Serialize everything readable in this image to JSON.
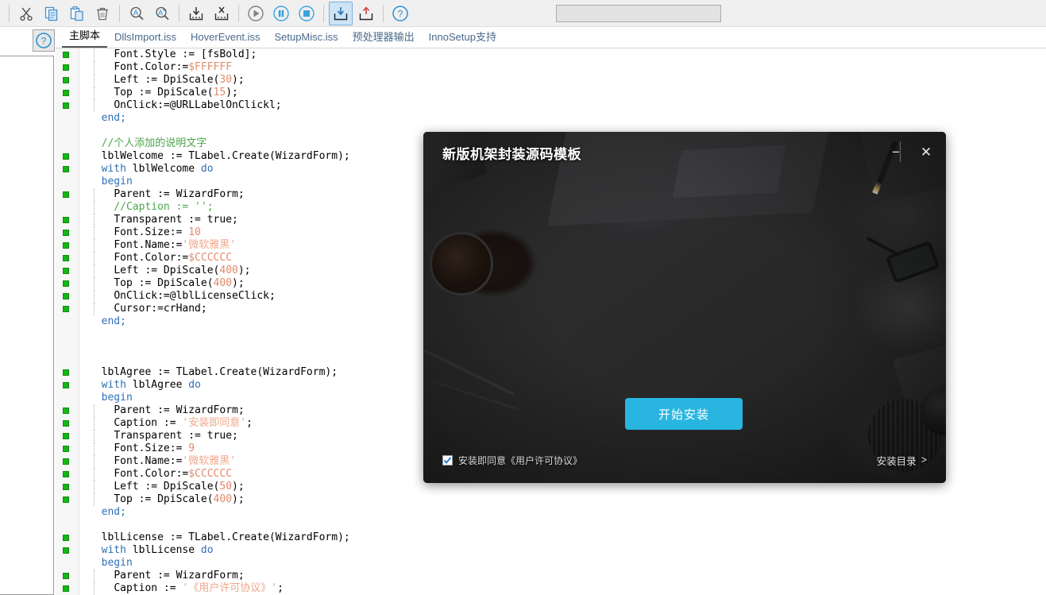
{
  "toolbar": {
    "buttons": [
      {
        "name": "cut-icon",
        "label": "剪切"
      },
      {
        "name": "copy-icon",
        "label": "复制"
      },
      {
        "name": "paste-icon",
        "label": "粘贴"
      },
      {
        "name": "delete-icon",
        "label": "删除"
      },
      {
        "name": "find-icon",
        "label": "查找"
      },
      {
        "name": "replace-icon",
        "label": "替换"
      },
      {
        "name": "import-icon",
        "label": "导入"
      },
      {
        "name": "remove-import-icon",
        "label": "移除导入"
      },
      {
        "name": "run-icon",
        "label": "运行"
      },
      {
        "name": "pause-icon",
        "label": "暂停"
      },
      {
        "name": "stop-icon",
        "label": "停止"
      },
      {
        "name": "download-icon",
        "label": "下载"
      },
      {
        "name": "upload-icon",
        "label": "上传"
      },
      {
        "name": "help-icon",
        "label": "帮助"
      }
    ],
    "search_value": "",
    "search_placeholder": ""
  },
  "help_button": {
    "glyph": "?",
    "label": "帮助"
  },
  "tabs": [
    {
      "label": "主脚本",
      "active": true
    },
    {
      "label": "DllsImport.iss",
      "active": false
    },
    {
      "label": "HoverEvent.iss",
      "active": false
    },
    {
      "label": "SetupMisc.iss",
      "active": false
    },
    {
      "label": "预处理器输出",
      "active": false
    },
    {
      "label": "InnoSetup支持",
      "active": false
    }
  ],
  "editor": {
    "lines": [
      {
        "marker": true,
        "indent": 4,
        "tokens": [
          {
            "t": "Font.Style := ",
            "c": "id"
          },
          {
            "t": "[fsBold];",
            "c": "pun"
          }
        ]
      },
      {
        "marker": true,
        "indent": 4,
        "tokens": [
          {
            "t": "Font.Color:=",
            "c": "id"
          },
          {
            "t": "$FFFFFF",
            "c": "num"
          }
        ]
      },
      {
        "marker": true,
        "indent": 4,
        "tokens": [
          {
            "t": "Left := DpiScale(",
            "c": "id"
          },
          {
            "t": "30",
            "c": "num"
          },
          {
            "t": ");",
            "c": "pun"
          }
        ]
      },
      {
        "marker": true,
        "indent": 4,
        "tokens": [
          {
            "t": "Top := DpiScale(",
            "c": "id"
          },
          {
            "t": "15",
            "c": "num"
          },
          {
            "t": ");",
            "c": "pun"
          }
        ]
      },
      {
        "marker": true,
        "indent": 4,
        "tokens": [
          {
            "t": "OnClick:=@URLLabelOnClickl;",
            "c": "id"
          }
        ]
      },
      {
        "marker": false,
        "indent": 2,
        "tokens": [
          {
            "t": "end;",
            "c": "kw"
          }
        ]
      },
      {
        "marker": false,
        "indent": 0,
        "tokens": []
      },
      {
        "marker": false,
        "indent": 2,
        "tokens": [
          {
            "t": "//个人添加的说明文字",
            "c": "cm"
          }
        ]
      },
      {
        "marker": true,
        "indent": 2,
        "tokens": [
          {
            "t": "lblWelcome := TLabel.Create(WizardForm);",
            "c": "id"
          }
        ]
      },
      {
        "marker": true,
        "indent": 2,
        "tokens": [
          {
            "t": "with ",
            "c": "kw"
          },
          {
            "t": "lblWelcome ",
            "c": "id"
          },
          {
            "t": "do",
            "c": "kw"
          }
        ]
      },
      {
        "marker": false,
        "indent": 2,
        "tokens": [
          {
            "t": "begin",
            "c": "kw"
          }
        ]
      },
      {
        "marker": true,
        "indent": 4,
        "tokens": [
          {
            "t": "Parent := WizardForm;",
            "c": "id"
          }
        ]
      },
      {
        "marker": false,
        "indent": 4,
        "tokens": [
          {
            "t": "//Caption := '';",
            "c": "cm"
          }
        ]
      },
      {
        "marker": true,
        "indent": 4,
        "tokens": [
          {
            "t": "Transparent := true;",
            "c": "id"
          }
        ]
      },
      {
        "marker": true,
        "indent": 4,
        "tokens": [
          {
            "t": "Font.Size:= ",
            "c": "id"
          },
          {
            "t": "10",
            "c": "num"
          }
        ]
      },
      {
        "marker": true,
        "indent": 4,
        "tokens": [
          {
            "t": "Font.Name:=",
            "c": "id"
          },
          {
            "t": "'微软雅黑'",
            "c": "str"
          }
        ]
      },
      {
        "marker": true,
        "indent": 4,
        "tokens": [
          {
            "t": "Font.Color:=",
            "c": "id"
          },
          {
            "t": "$CCCCCC",
            "c": "num"
          }
        ]
      },
      {
        "marker": true,
        "indent": 4,
        "tokens": [
          {
            "t": "Left := DpiScale(",
            "c": "id"
          },
          {
            "t": "400",
            "c": "num"
          },
          {
            "t": ");",
            "c": "pun"
          }
        ]
      },
      {
        "marker": true,
        "indent": 4,
        "tokens": [
          {
            "t": "Top := DpiScale(",
            "c": "id"
          },
          {
            "t": "400",
            "c": "num"
          },
          {
            "t": ");",
            "c": "pun"
          }
        ]
      },
      {
        "marker": true,
        "indent": 4,
        "tokens": [
          {
            "t": "OnClick:=@lblLicenseClick;",
            "c": "id"
          }
        ]
      },
      {
        "marker": true,
        "indent": 4,
        "tokens": [
          {
            "t": "Cursor:=crHand;",
            "c": "id"
          }
        ]
      },
      {
        "marker": false,
        "indent": 2,
        "tokens": [
          {
            "t": "end;",
            "c": "kw"
          }
        ]
      },
      {
        "marker": false,
        "indent": 0,
        "tokens": []
      },
      {
        "marker": false,
        "indent": 0,
        "tokens": []
      },
      {
        "marker": false,
        "indent": 0,
        "tokens": []
      },
      {
        "marker": true,
        "indent": 2,
        "tokens": [
          {
            "t": "lblAgree := TLabel.Create(WizardForm);",
            "c": "id"
          }
        ]
      },
      {
        "marker": true,
        "indent": 2,
        "tokens": [
          {
            "t": "with ",
            "c": "kw"
          },
          {
            "t": "lblAgree ",
            "c": "id"
          },
          {
            "t": "do",
            "c": "kw"
          }
        ]
      },
      {
        "marker": false,
        "indent": 2,
        "tokens": [
          {
            "t": "begin",
            "c": "kw"
          }
        ]
      },
      {
        "marker": true,
        "indent": 4,
        "tokens": [
          {
            "t": "Parent := WizardForm;",
            "c": "id"
          }
        ]
      },
      {
        "marker": true,
        "indent": 4,
        "tokens": [
          {
            "t": "Caption := ",
            "c": "id"
          },
          {
            "t": "'安装即同意'",
            "c": "str"
          },
          {
            "t": ";",
            "c": "pun"
          }
        ]
      },
      {
        "marker": true,
        "indent": 4,
        "tokens": [
          {
            "t": "Transparent := true;",
            "c": "id"
          }
        ]
      },
      {
        "marker": true,
        "indent": 4,
        "tokens": [
          {
            "t": "Font.Size:= ",
            "c": "id"
          },
          {
            "t": "9",
            "c": "num"
          }
        ]
      },
      {
        "marker": true,
        "indent": 4,
        "tokens": [
          {
            "t": "Font.Name:=",
            "c": "id"
          },
          {
            "t": "'微软雅黑'",
            "c": "str"
          }
        ]
      },
      {
        "marker": true,
        "indent": 4,
        "tokens": [
          {
            "t": "Font.Color:=",
            "c": "id"
          },
          {
            "t": "$CCCCCC",
            "c": "num"
          }
        ]
      },
      {
        "marker": true,
        "indent": 4,
        "tokens": [
          {
            "t": "Left := DpiScale(",
            "c": "id"
          },
          {
            "t": "50",
            "c": "num"
          },
          {
            "t": ");",
            "c": "pun"
          }
        ]
      },
      {
        "marker": true,
        "indent": 4,
        "tokens": [
          {
            "t": "Top := DpiScale(",
            "c": "id"
          },
          {
            "t": "400",
            "c": "num"
          },
          {
            "t": ");",
            "c": "pun"
          }
        ]
      },
      {
        "marker": false,
        "indent": 2,
        "tokens": [
          {
            "t": "end;",
            "c": "kw"
          }
        ]
      },
      {
        "marker": false,
        "indent": 0,
        "tokens": []
      },
      {
        "marker": true,
        "indent": 2,
        "tokens": [
          {
            "t": "lblLicense := TLabel.Create(WizardForm);",
            "c": "id"
          }
        ]
      },
      {
        "marker": true,
        "indent": 2,
        "tokens": [
          {
            "t": "with ",
            "c": "kw"
          },
          {
            "t": "lblLicense ",
            "c": "id"
          },
          {
            "t": "do",
            "c": "kw"
          }
        ]
      },
      {
        "marker": false,
        "indent": 2,
        "tokens": [
          {
            "t": "begin",
            "c": "kw"
          }
        ]
      },
      {
        "marker": true,
        "indent": 4,
        "tokens": [
          {
            "t": "Parent := WizardForm;",
            "c": "id"
          }
        ]
      },
      {
        "marker": true,
        "indent": 4,
        "tokens": [
          {
            "t": "Caption := ",
            "c": "id"
          },
          {
            "t": "'《用户许可协议》'",
            "c": "str"
          },
          {
            "t": ";",
            "c": "pun"
          }
        ]
      }
    ]
  },
  "installer": {
    "title": "新版机架封装源码模板",
    "minimize_label": "−",
    "close_label": "✕",
    "install_button": "开始安装",
    "agree_text": "安装即同意《用户许可协议》",
    "agree_checked": true,
    "directory_link": "安装目录",
    "directory_arrow": ">",
    "accent_color": "#28b6e0"
  }
}
